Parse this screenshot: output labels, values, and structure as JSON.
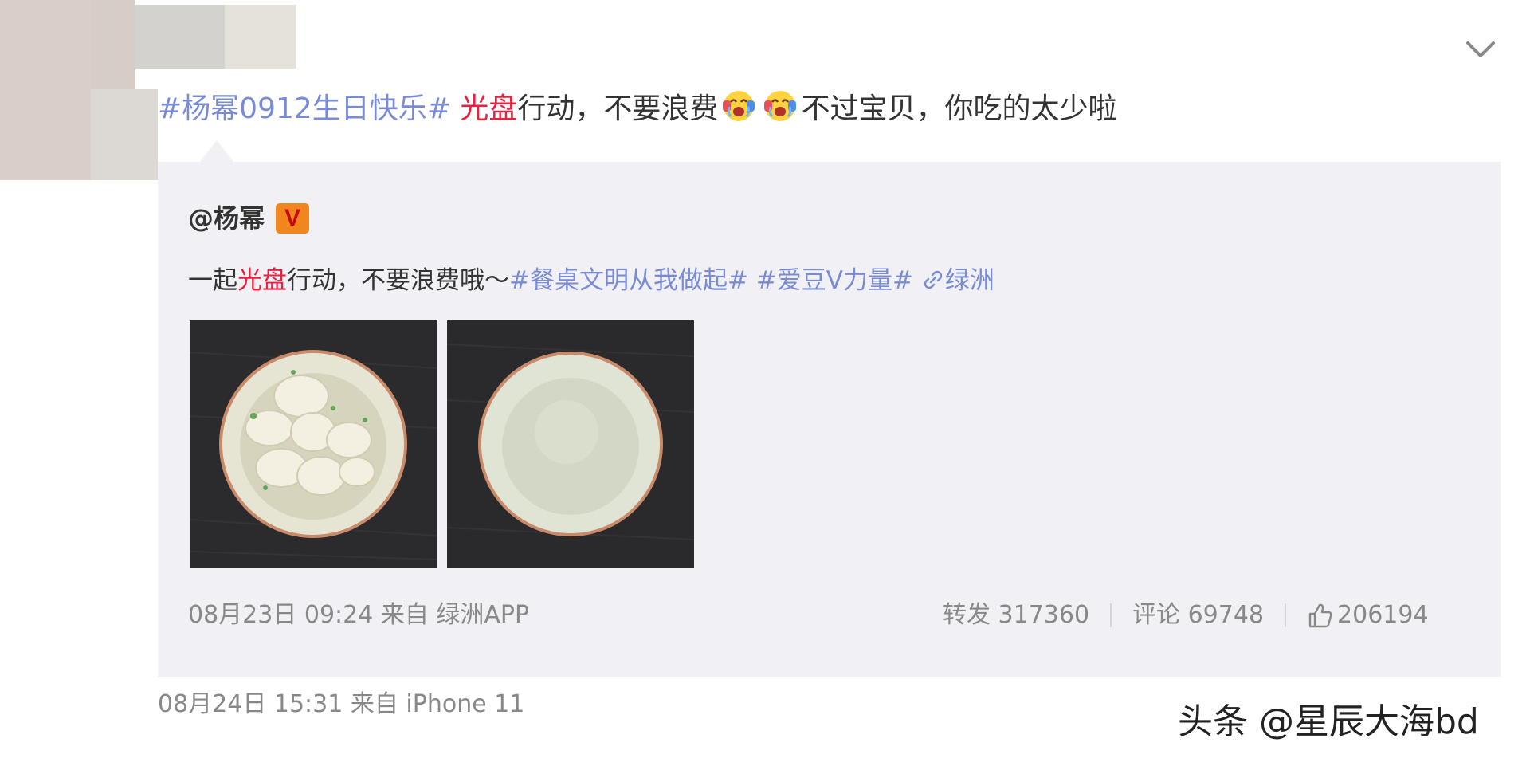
{
  "post": {
    "text_topic_1": "#杨幂0912生日快乐#",
    "text_hl_1": "光盘",
    "text_mid": "行动，不要浪费",
    "text_tail": "不过宝贝，你吃的太少啦",
    "emoji_name": "crying-laughing-emoji",
    "meta": "08月24日 15:31  来自 iPhone 11"
  },
  "quote": {
    "author": "@杨幂",
    "badge": "V",
    "text_prefix": "一起",
    "text_hl": "光盘",
    "text_mid": "行动，不要浪费哦～",
    "topic_1": "#餐桌文明从我做起#",
    "topic_2": "#爱豆V力量#",
    "location": "绿洲",
    "meta": "08月23日 09:24 来自 绿洲APP",
    "repost_label": "转发 317360",
    "comment_label": "评论 69748",
    "like_count": "206194",
    "photos": [
      {
        "name": "bowl-of-wontons-photo"
      },
      {
        "name": "empty-bowl-photo"
      }
    ]
  },
  "watermark": "头条 @星辰大海bd",
  "colors": {
    "topic": "#7a8bd6",
    "highlight": "#e8223e",
    "quote_bg": "#f1f1f5",
    "meta": "#888888",
    "badge": "#f0861d"
  },
  "icons": {
    "expand": "chevron-down-icon",
    "link": "link-icon",
    "like": "thumbs-up-icon"
  }
}
